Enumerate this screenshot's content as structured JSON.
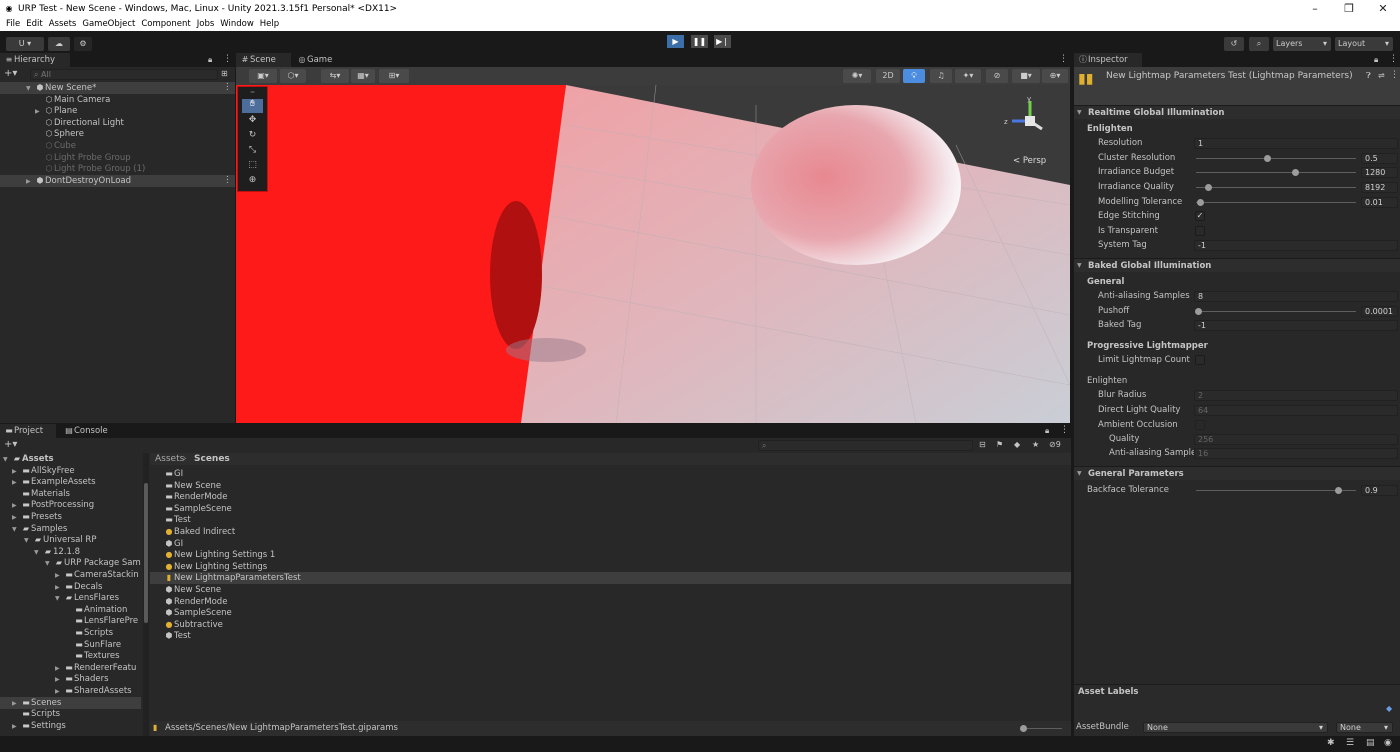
{
  "window": {
    "title": "URP Test - New Scene - Windows, Mac, Linux - Unity 2021.3.15f1 Personal* <DX11>",
    "minimize": "–",
    "maximize": "❐",
    "close": "✕"
  },
  "menu": [
    "File",
    "Edit",
    "Assets",
    "GameObject",
    "Component",
    "Jobs",
    "Window",
    "Help"
  ],
  "toolbar": {
    "account": "U ▾",
    "layers": "Layers",
    "layout": "Layout"
  },
  "hierarchy": {
    "tab": "Hierarchy",
    "search_placeholder": "All",
    "scene": "New Scene*",
    "items": [
      "Main Camera",
      "Plane",
      "Directional Light",
      "Sphere",
      "Cube",
      "Light Probe Group",
      "Light Probe Group (1)"
    ],
    "dont_destroy": "DontDestroyOnLoad"
  },
  "scene_view": {
    "tab_scene": "Scene",
    "tab_game": "Game",
    "btn_2d": "2D",
    "persp": "< Persp"
  },
  "project": {
    "tab_project": "Project",
    "tab_console": "Console",
    "breadcrumb_root": "Assets",
    "breadcrumb_current": "Scenes",
    "count": "9",
    "tree": [
      "Assets",
      "AllSkyFree",
      "ExampleAssets",
      "Materials",
      "PostProcessing",
      "Presets",
      "Samples",
      "Universal RP",
      "12.1.8",
      "URP Package Sam",
      "CameraStackin",
      "Decals",
      "LensFlares",
      "Animation",
      "LensFlarePre",
      "Scripts",
      "SunFlare",
      "Textures",
      "RendererFeatu",
      "Shaders",
      "SharedAssets",
      "Scenes",
      "Scripts",
      "Settings"
    ],
    "files": [
      "GI",
      "New Scene",
      "RenderMode",
      "SampleScene",
      "Test",
      "Baked Indirect",
      "GI",
      "New Lighting Settings 1",
      "New Lighting Settings",
      "New LightmapParametersTest",
      "New Scene",
      "RenderMode",
      "SampleScene",
      "Subtractive",
      "Test"
    ],
    "status_path": "Assets/Scenes/New LightmapParametersTest.giparams"
  },
  "inspector": {
    "tab": "Inspector",
    "object_title": "New Lightmap Parameters Test (Lightmap Parameters)",
    "realtime_gi": {
      "header": "Realtime Global Illumination",
      "subheader": "Enlighten",
      "resolution_label": "Resolution",
      "resolution": "1",
      "cluster_label": "Cluster Resolution",
      "cluster": "0.5",
      "irr_budget_label": "Irradiance Budget",
      "irr_budget": "1280",
      "irr_quality_label": "Irradiance Quality",
      "irr_quality": "8192",
      "modelling_label": "Modelling Tolerance",
      "modelling": "0.01",
      "edge_label": "Edge Stitching",
      "edge_checked": "✓",
      "transparent_label": "Is Transparent",
      "systag_label": "System Tag",
      "systag": "-1"
    },
    "baked_gi": {
      "header": "Baked Global Illumination",
      "subheader": "General",
      "aa_label": "Anti-aliasing Samples",
      "aa": "8",
      "pushoff_label": "Pushoff",
      "pushoff": "0.0001",
      "bakedtag_label": "Baked Tag",
      "bakedtag": "-1",
      "progressive_header": "Progressive Lightmapper",
      "limit_label": "Limit Lightmap Count",
      "enlighten_header": "Enlighten",
      "blur_label": "Blur Radius",
      "blur": "2",
      "dlq_label": "Direct Light Quality",
      "dlq": "64",
      "ao_label": "Ambient Occlusion",
      "quality_label": "Quality",
      "quality": "256",
      "aas_label": "Anti-aliasing Sample",
      "aas": "16"
    },
    "general_params": {
      "header": "General Parameters",
      "backface_label": "Backface Tolerance",
      "backface": "0.9"
    },
    "asset_labels": "Asset Labels",
    "assetbundle_label": "AssetBundle",
    "assetbundle_value": "None",
    "assetbundle_variant": "None"
  },
  "colors": {
    "red_wall": "#ff1a1a",
    "sphere": "#e88890",
    "accent": "#4d8de0"
  }
}
